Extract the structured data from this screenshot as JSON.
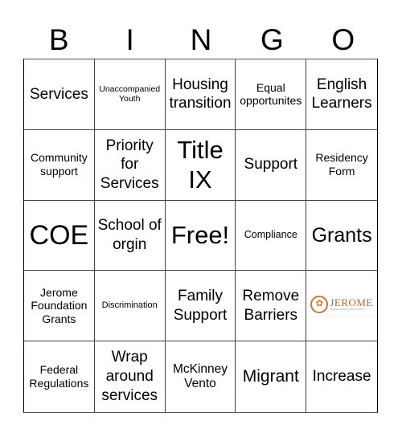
{
  "header": {
    "letters": [
      "B",
      "I",
      "N",
      "G",
      "O"
    ]
  },
  "cells": [
    {
      "text": "Services"
    },
    {
      "text": "Unaccompanied Youth"
    },
    {
      "text": "Housing transition"
    },
    {
      "text": "Equal opportunites"
    },
    {
      "text": "English Learners"
    },
    {
      "text": "Community support"
    },
    {
      "text": "Priority for Services"
    },
    {
      "text": "Title IX"
    },
    {
      "text": "Support"
    },
    {
      "text": "Residency Form"
    },
    {
      "text": "COE"
    },
    {
      "text": "School of orgin"
    },
    {
      "text": "Free!"
    },
    {
      "text": "Compliance"
    },
    {
      "text": "Grants"
    },
    {
      "text": "Jerome Foundation Grants"
    },
    {
      "text": "Discrimination"
    },
    {
      "text": "Family Support"
    },
    {
      "text": "Remove Barriers"
    },
    {
      "text": "",
      "logo": {
        "word": "JEROME",
        "subtitle": "WHERE EXPERT EDUCATION",
        "icon": "lion-crest-icon",
        "color": "#b06a35"
      }
    },
    {
      "text": "Federal Regulations"
    },
    {
      "text": "Wrap around services"
    },
    {
      "text": "McKinney Vento"
    },
    {
      "text": "Migrant"
    },
    {
      "text": "Increase"
    }
  ]
}
